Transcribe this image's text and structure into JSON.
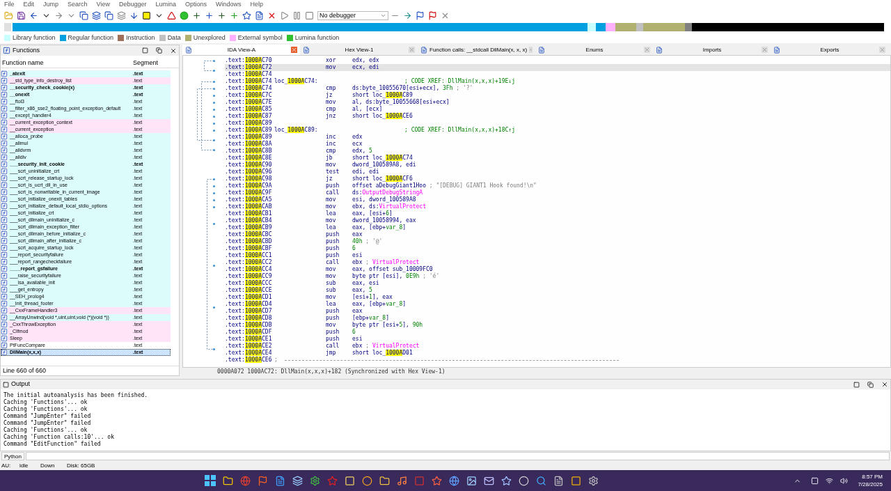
{
  "menu": [
    "File",
    "Edit",
    "Jump",
    "Search",
    "View",
    "Debugger",
    "Lumina",
    "Options",
    "Windows",
    "Help"
  ],
  "toolbar": {
    "debugger_select": "No debugger"
  },
  "legend": [
    {
      "label": "Library function",
      "color": "#c8ffff"
    },
    {
      "label": "Regular function",
      "color": "#00a0e0"
    },
    {
      "label": "Instruction",
      "color": "#a0705a"
    },
    {
      "label": "Data",
      "color": "#c0c0c0"
    },
    {
      "label": "Unexplored",
      "color": "#b0b070"
    },
    {
      "label": "External symbol",
      "color": "#ffb0ff"
    },
    {
      "label": "Lumina function",
      "color": "#30c030"
    }
  ],
  "functions": {
    "title": "Functions",
    "columns": [
      "Function name",
      "Segment"
    ],
    "rows": [
      {
        "name": "_atexit",
        "segment": ".text",
        "bold": true,
        "color": "#dcfcfc",
        "selected": false
      },
      {
        "name": "__std_type_info_destroy_list",
        "segment": ".text",
        "bold": false,
        "color": "#ffe4f8",
        "selected": false
      },
      {
        "name": "__security_check_cookie(x)",
        "segment": ".text",
        "bold": true,
        "color": "#dcfcfc",
        "selected": false
      },
      {
        "name": "__onexit",
        "segment": ".text",
        "bold": true,
        "color": "#dcfcfc",
        "selected": false
      },
      {
        "name": "__ftol3",
        "segment": ".text",
        "bold": false,
        "color": "#dcfcfc",
        "selected": false
      },
      {
        "name": "__filter_x86_sse2_floating_point_exception_default",
        "segment": ".text",
        "bold": false,
        "color": "#dcfcfc",
        "selected": false
      },
      {
        "name": "__except_handler4",
        "segment": ".text",
        "bold": false,
        "color": "#dcfcfc",
        "selected": false
      },
      {
        "name": "__current_exception_context",
        "segment": ".text",
        "bold": false,
        "color": "#ffe4f8",
        "selected": false
      },
      {
        "name": "__current_exception",
        "segment": ".text",
        "bold": false,
        "color": "#ffe4f8",
        "selected": false
      },
      {
        "name": "__alloca_probe",
        "segment": ".text",
        "bold": false,
        "color": "#dcfcfc",
        "selected": false
      },
      {
        "name": "__allmul",
        "segment": ".text",
        "bold": false,
        "color": "#dcfcfc",
        "selected": false
      },
      {
        "name": "__alldvrm",
        "segment": ".text",
        "bold": false,
        "color": "#dcfcfc",
        "selected": false
      },
      {
        "name": "__alldiv",
        "segment": ".text",
        "bold": false,
        "color": "#dcfcfc",
        "selected": false
      },
      {
        "name": "___security_init_cookie",
        "segment": ".text",
        "bold": true,
        "color": "#dcfcfc",
        "selected": false
      },
      {
        "name": "___scrt_uninitialize_crt",
        "segment": ".text",
        "bold": false,
        "color": "#dcfcfc",
        "selected": false
      },
      {
        "name": "___scrt_release_startup_lock",
        "segment": ".text",
        "bold": false,
        "color": "#dcfcfc",
        "selected": false
      },
      {
        "name": "___scrt_is_ucrt_dll_in_use",
        "segment": ".text",
        "bold": false,
        "color": "#dcfcfc",
        "selected": false
      },
      {
        "name": "___scrt_is_nonwritable_in_current_image",
        "segment": ".text",
        "bold": false,
        "color": "#dcfcfc",
        "selected": false
      },
      {
        "name": "___scrt_initialize_onexit_tables",
        "segment": ".text",
        "bold": false,
        "color": "#dcfcfc",
        "selected": false
      },
      {
        "name": "___scrt_initialize_default_local_stdio_options",
        "segment": ".text",
        "bold": false,
        "color": "#dcfcfc",
        "selected": false
      },
      {
        "name": "___scrt_initialize_crt",
        "segment": ".text",
        "bold": false,
        "color": "#dcfcfc",
        "selected": false
      },
      {
        "name": "___scrt_dllmain_uninitialize_c",
        "segment": ".text",
        "bold": false,
        "color": "#dcfcfc",
        "selected": false
      },
      {
        "name": "___scrt_dllmain_exception_filter",
        "segment": ".text",
        "bold": false,
        "color": "#dcfcfc",
        "selected": false
      },
      {
        "name": "___scrt_dllmain_before_initialize_c",
        "segment": ".text",
        "bold": false,
        "color": "#dcfcfc",
        "selected": false
      },
      {
        "name": "___scrt_dllmain_after_initialize_c",
        "segment": ".text",
        "bold": false,
        "color": "#dcfcfc",
        "selected": false
      },
      {
        "name": "___scrt_acquire_startup_lock",
        "segment": ".text",
        "bold": false,
        "color": "#dcfcfc",
        "selected": false
      },
      {
        "name": "___report_securityfailure",
        "segment": ".text",
        "bold": false,
        "color": "#dcfcfc",
        "selected": false
      },
      {
        "name": "___report_rangecheckfailure",
        "segment": ".text",
        "bold": false,
        "color": "#dcfcfc",
        "selected": false
      },
      {
        "name": "____report_gsfailure",
        "segment": ".text",
        "bold": true,
        "color": "#dcfcfc",
        "selected": false
      },
      {
        "name": "___raise_securityfailure",
        "segment": ".text",
        "bold": false,
        "color": "#dcfcfc",
        "selected": false
      },
      {
        "name": "___isa_available_init",
        "segment": ".text",
        "bold": false,
        "color": "#dcfcfc",
        "selected": false
      },
      {
        "name": "___get_entropy",
        "segment": ".text",
        "bold": false,
        "color": "#dcfcfc",
        "selected": false
      },
      {
        "name": "__SEH_prolog4",
        "segment": ".text",
        "bold": false,
        "color": "#dcfcfc",
        "selected": false
      },
      {
        "name": "__Init_thread_footer",
        "segment": ".text",
        "bold": false,
        "color": "#dcfcfc",
        "selected": false
      },
      {
        "name": "__CxxFrameHandler3",
        "segment": ".text",
        "bold": false,
        "color": "#ffe4f8",
        "selected": false
      },
      {
        "name": "__ArrayUnwind(void *,uint,uint,void (*)(void *))",
        "segment": ".text",
        "bold": false,
        "color": "#dcfcfc",
        "selected": false
      },
      {
        "name": "_CxxThrowException",
        "segment": ".text",
        "bold": false,
        "color": "#ffe4f8",
        "selected": false
      },
      {
        "name": "_CIfmod",
        "segment": ".text",
        "bold": false,
        "color": "#ffe4f8",
        "selected": false
      },
      {
        "name": "Sleep",
        "segment": ".text",
        "bold": false,
        "color": "#ffe4f8",
        "selected": false
      },
      {
        "name": "PtFuncCompare",
        "segment": ".text",
        "bold": false,
        "color": "#ffffff",
        "selected": false
      },
      {
        "name": "DllMain(x,x,x)",
        "segment": ".text",
        "bold": true,
        "color": "#cce4ff",
        "selected": true
      }
    ],
    "status": "Line 660 of 660"
  },
  "tabs": [
    {
      "label": "IDA View-A",
      "selected": true
    },
    {
      "label": "Hex View-1",
      "selected": false
    },
    {
      "label": "Function calls: __stdcall DllMain(x, x, x)",
      "selected": false
    },
    {
      "label": "Enums",
      "selected": false
    },
    {
      "label": "Imports",
      "selected": false
    },
    {
      "label": "Exports",
      "selected": false
    }
  ],
  "code": {
    "lines": [
      {
        "seg": ".text:",
        "addr_hl": "1000A",
        "addr_rest": "C70",
        "mnem": "xor",
        "ops": [
          {
            "text": "edx, edx",
            "kind": "plain"
          }
        ],
        "selected": false
      },
      {
        "seg": ".text:",
        "addr_hl": "1000A",
        "addr_rest": "C72",
        "mnem": "mov",
        "ops": [
          {
            "text": "ecx, edi",
            "kind": "plain"
          }
        ],
        "selected": true
      },
      {
        "seg": ".text:",
        "addr_hl": "1000A",
        "addr_rest": "C74",
        "selected": false
      },
      {
        "seg": ".text:",
        "addr_hl": "1000A",
        "addr_rest": "C74",
        "label": [
          {
            "text": "loc_",
            "kind": "plain"
          },
          {
            "text": "1000A",
            "kind": "hl"
          },
          {
            "text": "C74:",
            "kind": "plain"
          }
        ],
        "ops": [
          {
            "text": "; CODE XREF: DllMain(x,x,x)+19E↓j",
            "kind": "xref"
          }
        ],
        "selected": false
      },
      {
        "seg": ".text:",
        "addr_hl": "1000A",
        "addr_rest": "C74",
        "mnem": "cmp",
        "ops": [
          {
            "text": "ds:byte_10055670[esi+ecx], ",
            "kind": "plain"
          },
          {
            "text": "3Fh",
            "kind": "num"
          },
          {
            "text": " ; '?'",
            "kind": "cmt"
          }
        ],
        "selected": false
      },
      {
        "seg": ".text:",
        "addr_hl": "1000A",
        "addr_rest": "C7C",
        "mnem": "jz",
        "ops": [
          {
            "text": "short loc_",
            "kind": "plain"
          },
          {
            "text": "1000A",
            "kind": "hl"
          },
          {
            "text": "C89",
            "kind": "plain"
          }
        ],
        "selected": false
      },
      {
        "seg": ".text:",
        "addr_hl": "1000A",
        "addr_rest": "C7E",
        "mnem": "mov",
        "ops": [
          {
            "text": "al, ds:byte_10055668[esi+ecx]",
            "kind": "plain"
          }
        ],
        "selected": false
      },
      {
        "seg": ".text:",
        "addr_hl": "1000A",
        "addr_rest": "C85",
        "mnem": "cmp",
        "ops": [
          {
            "text": "al, [ecx]",
            "kind": "plain"
          }
        ],
        "selected": false
      },
      {
        "seg": ".text:",
        "addr_hl": "1000A",
        "addr_rest": "C87",
        "mnem": "jnz",
        "ops": [
          {
            "text": "short loc_",
            "kind": "plain"
          },
          {
            "text": "1000A",
            "kind": "hl"
          },
          {
            "text": "CE6",
            "kind": "plain"
          }
        ],
        "selected": false
      },
      {
        "seg": ".text:",
        "addr_hl": "1000A",
        "addr_rest": "C89",
        "selected": false
      },
      {
        "seg": ".text:",
        "addr_hl": "1000A",
        "addr_rest": "C89",
        "label": [
          {
            "text": "loc_",
            "kind": "plain"
          },
          {
            "text": "1000A",
            "kind": "hl"
          },
          {
            "text": "C89:",
            "kind": "plain"
          }
        ],
        "ops": [
          {
            "text": "; CODE XREF: DllMain(x,x,x)+18C↑j",
            "kind": "xref"
          }
        ],
        "selected": false
      },
      {
        "seg": ".text:",
        "addr_hl": "1000A",
        "addr_rest": "C89",
        "mnem": "inc",
        "ops": [
          {
            "text": "edx",
            "kind": "plain"
          }
        ],
        "selected": false
      },
      {
        "seg": ".text:",
        "addr_hl": "1000A",
        "addr_rest": "C8A",
        "mnem": "inc",
        "ops": [
          {
            "text": "ecx",
            "kind": "plain"
          }
        ],
        "selected": false
      },
      {
        "seg": ".text:",
        "addr_hl": "1000A",
        "addr_rest": "C8B",
        "mnem": "cmp",
        "ops": [
          {
            "text": "edx, ",
            "kind": "plain"
          },
          {
            "text": "5",
            "kind": "num"
          }
        ],
        "selected": false
      },
      {
        "seg": ".text:",
        "addr_hl": "1000A",
        "addr_rest": "C8E",
        "mnem": "jb",
        "ops": [
          {
            "text": "short loc_",
            "kind": "plain"
          },
          {
            "text": "1000A",
            "kind": "hl"
          },
          {
            "text": "C74",
            "kind": "plain"
          }
        ],
        "selected": false
      },
      {
        "seg": ".text:",
        "addr_hl": "1000A",
        "addr_rest": "C90",
        "mnem": "mov",
        "ops": [
          {
            "text": "dword_100589A8, edi",
            "kind": "plain"
          }
        ],
        "selected": false
      },
      {
        "seg": ".text:",
        "addr_hl": "1000A",
        "addr_rest": "C96",
        "mnem": "test",
        "ops": [
          {
            "text": "edi, edi",
            "kind": "plain"
          }
        ],
        "selected": false
      },
      {
        "seg": ".text:",
        "addr_hl": "1000A",
        "addr_rest": "C98",
        "mnem": "jz",
        "ops": [
          {
            "text": "short loc_",
            "kind": "plain"
          },
          {
            "text": "1000A",
            "kind": "hl"
          },
          {
            "text": "CF6",
            "kind": "plain"
          }
        ],
        "selected": false
      },
      {
        "seg": ".text:",
        "addr_hl": "1000A",
        "addr_rest": "C9A",
        "mnem": "push",
        "ops": [
          {
            "text": "offset aDebugGiant1Hoo",
            "kind": "plain"
          },
          {
            "text": " ; \"[DEBUG] GIANT1 Hook found!\\n\"",
            "kind": "cmt"
          }
        ],
        "selected": false
      },
      {
        "seg": ".text:",
        "addr_hl": "1000A",
        "addr_rest": "C9F",
        "mnem": "call",
        "ops": [
          {
            "text": "ds:",
            "kind": "plain"
          },
          {
            "text": "OutputDebugStringA",
            "kind": "api"
          }
        ],
        "selected": false
      },
      {
        "seg": ".text:",
        "addr_hl": "1000A",
        "addr_rest": "CA5",
        "mnem": "mov",
        "ops": [
          {
            "text": "esi, dword_100589A8",
            "kind": "plain"
          }
        ],
        "selected": false
      },
      {
        "seg": ".text:",
        "addr_hl": "1000A",
        "addr_rest": "CAB",
        "mnem": "mov",
        "ops": [
          {
            "text": "ebx, ds:",
            "kind": "plain"
          },
          {
            "text": "VirtualProtect",
            "kind": "api"
          }
        ],
        "selected": false
      },
      {
        "seg": ".text:",
        "addr_hl": "1000A",
        "addr_rest": "CB1",
        "mnem": "lea",
        "ops": [
          {
            "text": "eax, [esi+",
            "kind": "plain"
          },
          {
            "text": "6",
            "kind": "num"
          },
          {
            "text": "]",
            "kind": "plain"
          }
        ],
        "selected": false
      },
      {
        "seg": ".text:",
        "addr_hl": "1000A",
        "addr_rest": "CB4",
        "mnem": "mov",
        "ops": [
          {
            "text": "dword_10058994, eax",
            "kind": "plain"
          }
        ],
        "selected": false
      },
      {
        "seg": ".text:",
        "addr_hl": "1000A",
        "addr_rest": "CB9",
        "mnem": "lea",
        "ops": [
          {
            "text": "eax, [ebp+",
            "kind": "plain"
          },
          {
            "text": "var_8",
            "kind": "num"
          },
          {
            "text": "]",
            "kind": "plain"
          }
        ],
        "selected": false
      },
      {
        "seg": ".text:",
        "addr_hl": "1000A",
        "addr_rest": "CBC",
        "mnem": "push",
        "ops": [
          {
            "text": "eax",
            "kind": "plain"
          }
        ],
        "selected": false
      },
      {
        "seg": ".text:",
        "addr_hl": "1000A",
        "addr_rest": "CBD",
        "mnem": "push",
        "ops": [
          {
            "text": "40h",
            "kind": "num"
          },
          {
            "text": " ; '@'",
            "kind": "cmt"
          }
        ],
        "selected": false
      },
      {
        "seg": ".text:",
        "addr_hl": "1000A",
        "addr_rest": "CBF",
        "mnem": "push",
        "ops": [
          {
            "text": "6",
            "kind": "num"
          }
        ],
        "selected": false
      },
      {
        "seg": ".text:",
        "addr_hl": "1000A",
        "addr_rest": "CC1",
        "mnem": "push",
        "ops": [
          {
            "text": "esi",
            "kind": "plain"
          }
        ],
        "selected": false
      },
      {
        "seg": ".text:",
        "addr_hl": "1000A",
        "addr_rest": "CC2",
        "mnem": "call",
        "ops": [
          {
            "text": "ebx",
            "kind": "plain"
          },
          {
            "text": " ; ",
            "kind": "cmt"
          },
          {
            "text": "VirtualProtect",
            "kind": "api"
          }
        ],
        "selected": false
      },
      {
        "seg": ".text:",
        "addr_hl": "1000A",
        "addr_rest": "CC4",
        "mnem": "mov",
        "ops": [
          {
            "text": "eax, offset sub_10009FC0",
            "kind": "plain"
          }
        ],
        "selected": false
      },
      {
        "seg": ".text:",
        "addr_hl": "1000A",
        "addr_rest": "CC9",
        "mnem": "mov",
        "ops": [
          {
            "text": "byte ptr [esi], ",
            "kind": "plain"
          },
          {
            "text": "0E9h",
            "kind": "num"
          },
          {
            "text": " ; 'é'",
            "kind": "cmt"
          }
        ],
        "selected": false
      },
      {
        "seg": ".text:",
        "addr_hl": "1000A",
        "addr_rest": "CCC",
        "mnem": "sub",
        "ops": [
          {
            "text": "eax, esi",
            "kind": "plain"
          }
        ],
        "selected": false
      },
      {
        "seg": ".text:",
        "addr_hl": "1000A",
        "addr_rest": "CCE",
        "mnem": "sub",
        "ops": [
          {
            "text": "eax, ",
            "kind": "plain"
          },
          {
            "text": "5",
            "kind": "num"
          }
        ],
        "selected": false
      },
      {
        "seg": ".text:",
        "addr_hl": "1000A",
        "addr_rest": "CD1",
        "mnem": "mov",
        "ops": [
          {
            "text": "[esi+",
            "kind": "plain"
          },
          {
            "text": "1",
            "kind": "num"
          },
          {
            "text": "], eax",
            "kind": "plain"
          }
        ],
        "selected": false
      },
      {
        "seg": ".text:",
        "addr_hl": "1000A",
        "addr_rest": "CD4",
        "mnem": "lea",
        "ops": [
          {
            "text": "eax, [ebp+",
            "kind": "plain"
          },
          {
            "text": "var_8",
            "kind": "num"
          },
          {
            "text": "]",
            "kind": "plain"
          }
        ],
        "selected": false
      },
      {
        "seg": ".text:",
        "addr_hl": "1000A",
        "addr_rest": "CD7",
        "mnem": "push",
        "ops": [
          {
            "text": "eax",
            "kind": "plain"
          }
        ],
        "selected": false
      },
      {
        "seg": ".text:",
        "addr_hl": "1000A",
        "addr_rest": "CD8",
        "mnem": "push",
        "ops": [
          {
            "text": "[ebp+",
            "kind": "plain"
          },
          {
            "text": "var_8",
            "kind": "num"
          },
          {
            "text": "]",
            "kind": "plain"
          }
        ],
        "selected": false
      },
      {
        "seg": ".text:",
        "addr_hl": "1000A",
        "addr_rest": "CDB",
        "mnem": "mov",
        "ops": [
          {
            "text": "byte ptr [esi+",
            "kind": "plain"
          },
          {
            "text": "5",
            "kind": "num"
          },
          {
            "text": "], ",
            "kind": "plain"
          },
          {
            "text": "90h",
            "kind": "num"
          }
        ],
        "selected": false
      },
      {
        "seg": ".text:",
        "addr_hl": "1000A",
        "addr_rest": "CDF",
        "mnem": "push",
        "ops": [
          {
            "text": "6",
            "kind": "num"
          }
        ],
        "selected": false
      },
      {
        "seg": ".text:",
        "addr_hl": "1000A",
        "addr_rest": "CE1",
        "mnem": "push",
        "ops": [
          {
            "text": "esi",
            "kind": "plain"
          }
        ],
        "selected": false
      },
      {
        "seg": ".text:",
        "addr_hl": "1000A",
        "addr_rest": "CE2",
        "mnem": "call",
        "ops": [
          {
            "text": "ebx",
            "kind": "plain"
          },
          {
            "text": " ; ",
            "kind": "cmt"
          },
          {
            "text": "VirtualProtect",
            "kind": "api"
          }
        ],
        "selected": false
      },
      {
        "seg": ".text:",
        "addr_hl": "1000A",
        "addr_rest": "CE4",
        "mnem": "jmp",
        "ops": [
          {
            "text": "short loc_",
            "kind": "plain"
          },
          {
            "text": "1000A",
            "kind": "hl"
          },
          {
            "text": "D01",
            "kind": "plain"
          }
        ],
        "selected": false
      },
      {
        "seg": ".text:",
        "addr_hl": "1000A",
        "addr_rest": "CE6",
        "separator": ";",
        "selected": false
      }
    ],
    "status": "0000A072 1000AC72: DllMain(x,x,x)+182 (Synchronized with Hex View-1)"
  },
  "output": {
    "title": "Output",
    "lines": [
      "The initial autoanalysis has been finished.",
      "Caching 'Functions'... ok",
      "Caching 'Functions'... ok",
      "Command \"JumpEnter\" failed",
      "Command \"JumpEnter\" failed",
      "Caching 'Functions'... ok",
      "Caching 'Function calls:10'... ok",
      "Command \"EditFunction\" failed"
    ],
    "language": "Python"
  },
  "status_bar": [
    "AU:",
    "idle",
    "Down",
    "Disk: 65GB"
  ],
  "taskbar": {
    "time": "8:57 PM",
    "date": "7/28/2025"
  }
}
